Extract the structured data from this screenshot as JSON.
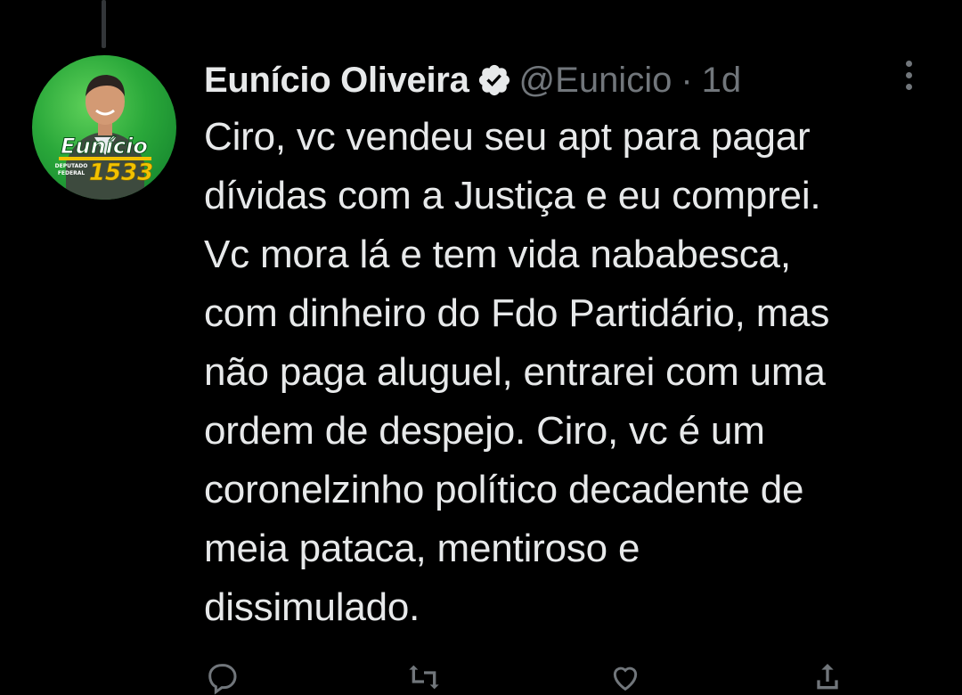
{
  "tweet": {
    "author_name": "Eunício Oliveira",
    "author_handle": "@Eunicio",
    "separator": "·",
    "timestamp": "1d",
    "verified_icon": "verified-badge-icon",
    "more_icon": "more-options-icon",
    "text": "Ciro, vc vendeu seu apt para pagar\ndívidas com a Justiça e eu comprei.\nVc mora lá e tem vida nababesca,\ncom dinheiro do Fdo Partidário, mas\nnão paga aluguel, entrarei com uma\nordem de despejo. Ciro, vc é um\ncoronelzinho político decadente de\nmeia pataca, mentiroso e\ndissimulado.",
    "avatar": {
      "name_text": "Eunício",
      "caption_line1": "DEPUTADO",
      "caption_line2": "FEDERAL",
      "number": "1533"
    }
  },
  "actions": [
    {
      "icon": "reply-icon"
    },
    {
      "icon": "retweet-icon"
    },
    {
      "icon": "like-icon"
    },
    {
      "icon": "share-icon"
    }
  ],
  "colors": {
    "background": "#000000",
    "primary_text": "#e7e9ea",
    "secondary_text": "#71767b",
    "avatar_green": "#2aa83a",
    "avatar_yellow": "#f2c200"
  }
}
